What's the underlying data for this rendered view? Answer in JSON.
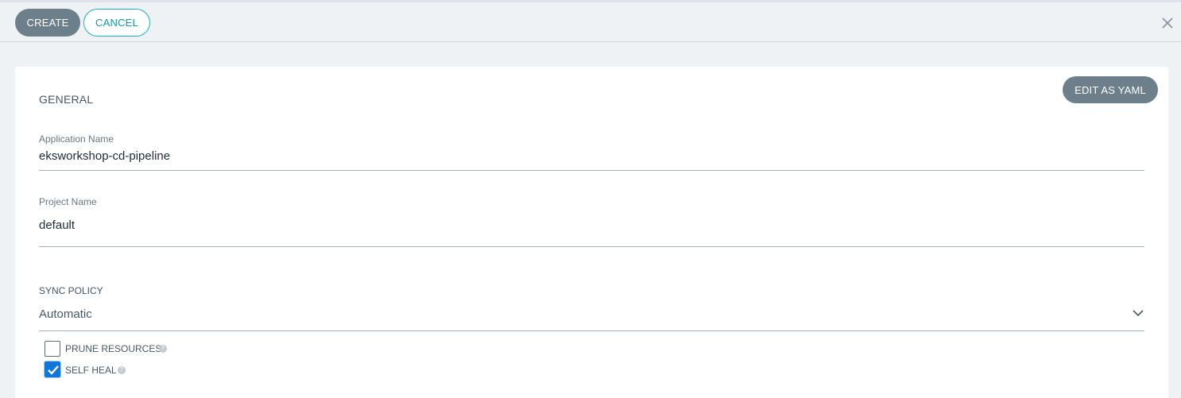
{
  "toolbar": {
    "create_label": "CREATE",
    "cancel_label": "CANCEL",
    "close_icon": "close-icon"
  },
  "panel": {
    "edit_yaml_label": "EDIT AS YAML",
    "general_title": "GENERAL",
    "application_name": {
      "label": "Application Name",
      "value": "eksworkshop-cd-pipeline"
    },
    "project_name": {
      "label": "Project Name",
      "value": "default"
    },
    "sync_policy": {
      "title": "SYNC POLICY",
      "selected": "Automatic",
      "options": [
        {
          "label": "PRUNE RESOURCES",
          "checked": false,
          "icon": "help-icon"
        },
        {
          "label": "SELF HEAL",
          "checked": true,
          "icon": "help-icon"
        }
      ]
    }
  },
  "colors": {
    "primary_button": "#6d7f8b",
    "accent_teal": "#19b2bf",
    "checkbox_checked": "#1176d9",
    "background": "#eef2f5"
  }
}
